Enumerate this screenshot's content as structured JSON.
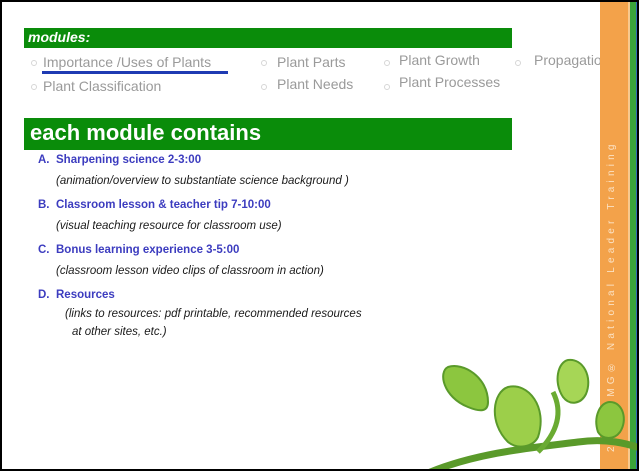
{
  "slide": {
    "modules_banner": "modules:",
    "modules": [
      "Importance /Uses of Plants",
      "Plant Parts",
      "Plant Growth",
      "Propagation",
      "Plant Classification",
      "Plant Needs",
      "Plant Processes"
    ],
    "each_banner": "each module contains",
    "items": [
      {
        "letter": "A.",
        "title": "Sharpening science 2-3:00",
        "desc": "(animation/overview to substantiate science background )"
      },
      {
        "letter": "B.",
        "title": "Classroom lesson & teacher tip 7-10:00",
        "desc": "(visual teaching resource for classroom use)"
      },
      {
        "letter": "C.",
        "title": "Bonus learning experience 3-5:00",
        "desc": "(classroom lesson video clips of classroom in action)"
      },
      {
        "letter": "D.",
        "title": "Resources",
        "desc_line1": "(links to resources: pdf printable, recommended resources",
        "desc_line2": "at other sites, etc.)"
      }
    ],
    "sidebar_text": "2019 JMG® National Leader Training"
  },
  "colors": {
    "banner_green": "#0a8c0a",
    "item_title_blue": "#3c3cbf",
    "module_link_gray": "#9a9a9a",
    "underline_blue": "#1f3bb3",
    "sidebar_orange": "#f3a24a"
  }
}
